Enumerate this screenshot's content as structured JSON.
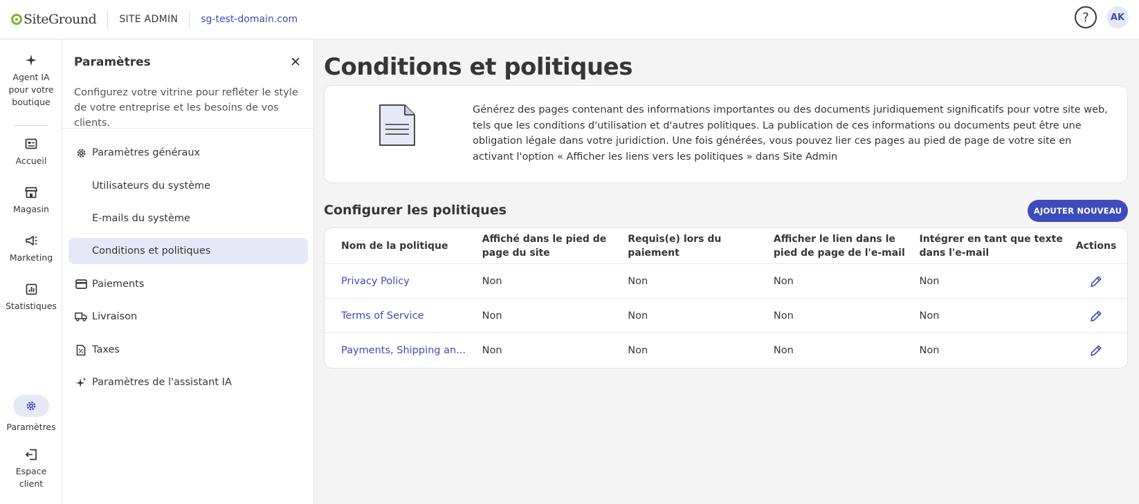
{
  "header": {
    "logo_text": "SiteGround",
    "section": "SITE ADMIN",
    "domain": "sg-test-domain.com",
    "help_icon": "help-icon",
    "avatar_initials": "AK"
  },
  "rail": {
    "items": [
      {
        "label": "Agent IA pour votre boutique",
        "icon": "sparkle-icon"
      },
      {
        "label": "Accueil",
        "icon": "home-icon"
      },
      {
        "label": "Magasin",
        "icon": "store-icon"
      },
      {
        "label": "Marketing",
        "icon": "megaphone-icon"
      },
      {
        "label": "Statistiques",
        "icon": "chart-icon"
      },
      {
        "label": "Paramètres",
        "icon": "gear-icon",
        "active": true
      },
      {
        "label": "Espace client",
        "icon": "exit-icon"
      }
    ]
  },
  "panel": {
    "title": "Paramètres",
    "description": "Configurez votre vitrine pour refléter le style de votre entreprise et les besoins de vos clients.",
    "nav": [
      {
        "label": "Paramètres généraux",
        "icon": "gear-icon"
      },
      {
        "label": "Utilisateurs du système",
        "sub": true
      },
      {
        "label": "E-mails du système",
        "sub": true
      },
      {
        "label": "Conditions et politiques",
        "sub": true,
        "active": true
      },
      {
        "label": "Paiements",
        "icon": "card-icon"
      },
      {
        "label": "Livraison",
        "icon": "truck-icon"
      },
      {
        "label": "Taxes",
        "icon": "tax-document-icon"
      },
      {
        "label": "Paramètres de l'assistant IA",
        "icon": "sparkle-icon"
      }
    ]
  },
  "main": {
    "title": "Conditions et politiques",
    "info_text": "Générez des pages contenant des informations importantes ou des documents juridiquement significatifs pour votre site web, tels que les conditions d'utilisation et d'autres politiques. La publication de ces informations ou documents peut être une obligation légale dans votre juridiction. Une fois générées, vous pouvez lier ces pages au pied de page de votre site en activant l'option « Afficher les liens vers les politiques » dans Site Admin",
    "section_title": "Configurer les politiques",
    "add_button": "AJOUTER NOUVEAU",
    "table": {
      "headers": [
        "Nom de la politique",
        "Affiché dans le pied de page du site",
        "Requis(e) lors du paiement",
        "Afficher le lien dans le pied de page de l'e-mail",
        "Intégrer en tant que texte dans l'e-mail",
        "Actions"
      ],
      "rows": [
        {
          "name": "Privacy Policy",
          "footer": "Non",
          "checkout": "Non",
          "email_link": "Non",
          "email_text": "Non"
        },
        {
          "name": "Terms of Service",
          "footer": "Non",
          "checkout": "Non",
          "email_link": "Non",
          "email_text": "Non"
        },
        {
          "name": "Payments, Shipping an...",
          "footer": "Non",
          "checkout": "Non",
          "email_link": "Non",
          "email_text": "Non"
        }
      ]
    }
  },
  "colors": {
    "accent": "#3e4bbd",
    "accent_light": "#e6e8f8",
    "logo_green": "#7bb32e",
    "background": "#f4f4f4"
  }
}
